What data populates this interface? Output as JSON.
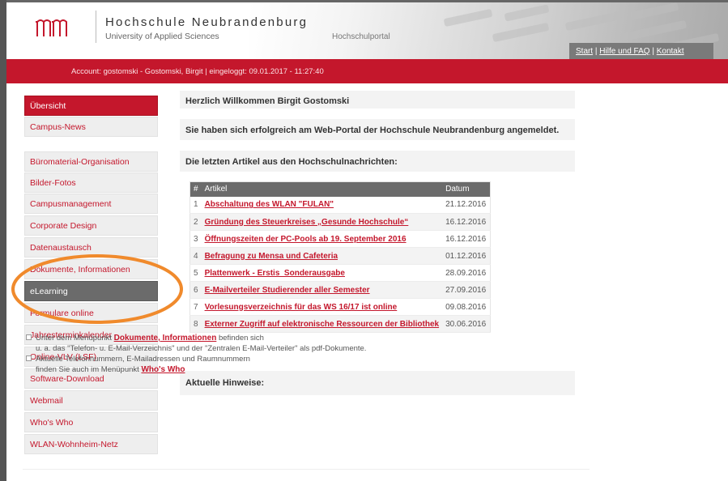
{
  "header": {
    "university_name": "Hochschule Neubrandenburg",
    "university_subtitle": "University of Applied Sciences",
    "portal_label": "Hochschulportal",
    "top_links": [
      "Start",
      "Hilfe und FAQ",
      "Kontakt"
    ],
    "separator": "|"
  },
  "account_bar": {
    "text": "Account: gostomski - Gostomski, Birgit | eingeloggt: 09.01.2017 - 11:27:40"
  },
  "sidebar": {
    "items": [
      {
        "label": "Übersicht",
        "state": "active"
      },
      {
        "label": "Campus-News",
        "state": "normal"
      },
      {
        "label": "Büromaterial-Organisation",
        "state": "normal"
      },
      {
        "label": "Bilder-Fotos",
        "state": "normal"
      },
      {
        "label": "Campusmanagement",
        "state": "normal"
      },
      {
        "label": "Corporate Design",
        "state": "normal"
      },
      {
        "label": "Datenaustausch",
        "state": "normal"
      },
      {
        "label": "Dokumente, Informationen",
        "state": "normal"
      },
      {
        "label": "eLearning",
        "state": "selected"
      },
      {
        "label": "Formulare online",
        "state": "normal"
      },
      {
        "label": "Jahresterminkalender",
        "state": "normal"
      },
      {
        "label": "Online-VLV (LSF)",
        "state": "normal"
      },
      {
        "label": "Software-Download",
        "state": "normal"
      },
      {
        "label": "Webmail",
        "state": "normal"
      },
      {
        "label": "Who's Who",
        "state": "normal"
      },
      {
        "label": "WLAN-Wohnheim-Netz",
        "state": "normal"
      }
    ]
  },
  "main": {
    "welcome": "Herzlich Willkommen Birgit Gostomski",
    "login_message": "Sie haben sich erfolgreich am Web-Portal der Hochschule Neubrandenburg angemeldet.",
    "news_heading": "Die letzten Artikel aus den Hochschulnachrichten:",
    "news_table": {
      "columns": [
        "#",
        "Artikel",
        "Datum"
      ],
      "rows": [
        {
          "num": "1",
          "title": "Abschaltung des WLAN \"FULAN\"",
          "date": "21.12.2016"
        },
        {
          "num": "2",
          "title": "Gründung des Steuerkreises „Gesunde Hochschule“",
          "date": "16.12.2016"
        },
        {
          "num": "3",
          "title": "Öffnungszeiten der PC-Pools ab 19. September 2016",
          "date": "16.12.2016"
        },
        {
          "num": "4",
          "title": "Befragung zu Mensa und Cafeteria",
          "date": "01.12.2016"
        },
        {
          "num": "5",
          "title": "Plattenwerk - Erstis_Sonderausgabe",
          "date": "28.09.2016"
        },
        {
          "num": "6",
          "title": "E-Mailverteiler Studierender aller Semester",
          "date": "27.09.2016"
        },
        {
          "num": "7",
          "title": "Vorlesungsverzeichnis für das WS 16/17 ist online",
          "date": "09.08.2016"
        },
        {
          "num": "8",
          "title": "Externer Zugriff auf elektronische Ressourcen der Bibliothek",
          "date": "30.06.2016"
        }
      ]
    },
    "hints_heading": "Aktuelle Hinweise:",
    "hint1": {
      "before": "Unter dem Menüpunkt ",
      "link": "Dokumente, Informationen",
      "after": " befinden sich",
      "line2": "u. a. das \"Telefon- u. E-Mail-Verzeichnis\" und der \"Zentralen E-Mail-Verteiler\" als pdf-Dokumente."
    },
    "hint2": {
      "line1": "Aktuelle Telefonnummern, E-Mailadressen und Raumnummern",
      "before": "finden Sie auch im Menüpunkt ",
      "link": "Who's Who"
    }
  },
  "colors": {
    "brand_red": "#c4172c",
    "nav_selected": "#6b6b6b",
    "annotation_orange": "#f08a2c"
  },
  "icons": {
    "logo": "university-logo-icon",
    "checkbox": "bullet-box-icon"
  }
}
